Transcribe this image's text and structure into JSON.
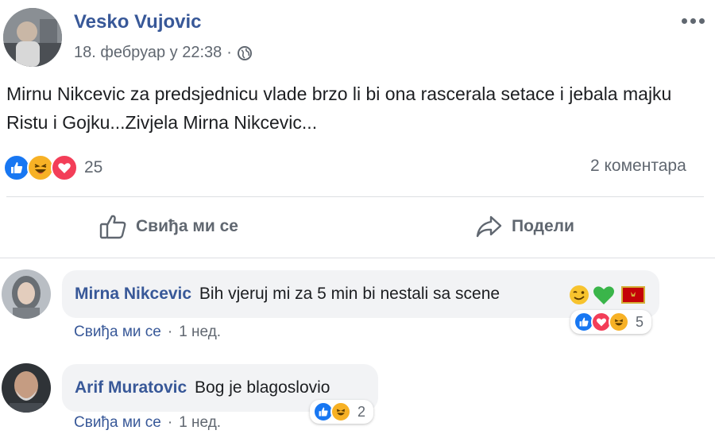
{
  "post": {
    "author": "Vesko Vujovic",
    "timestamp": "18. фебруар у 22:38",
    "separator": "·",
    "privacy_icon": "globe-icon",
    "text": "Mirnu Nikcevic za predsjednicu vlade brzo li bi ona rascerala setace i jebala majku Ristu i Gojku...Zivjela Mirna Nikcevic...",
    "options_icon": "more-dots-icon",
    "reaction_count": "25",
    "comment_count": "2 коментара"
  },
  "actions": {
    "like_label": "Свиђа ми се",
    "share_label": "Подели"
  },
  "comments": [
    {
      "author": "Mirna Nikcevic",
      "text": "Bih vjeruj mi za 5 min bi nestali sa scene",
      "like_label": "Свиђа ми се",
      "separator": "·",
      "age": "1 нед.",
      "reaction_count": "5"
    },
    {
      "author": "Arif Muratovic",
      "text": "Bog je blagoslovio",
      "like_label": "Свиђа ми се",
      "separator": "·",
      "age": "1 нед.",
      "reaction_count": "2"
    }
  ],
  "colors": {
    "like_blue": "#1877f2",
    "love_red": "#f33e58",
    "haha_yellow": "#f7b125",
    "link_blue": "#385898",
    "meta_gray": "#606770"
  }
}
